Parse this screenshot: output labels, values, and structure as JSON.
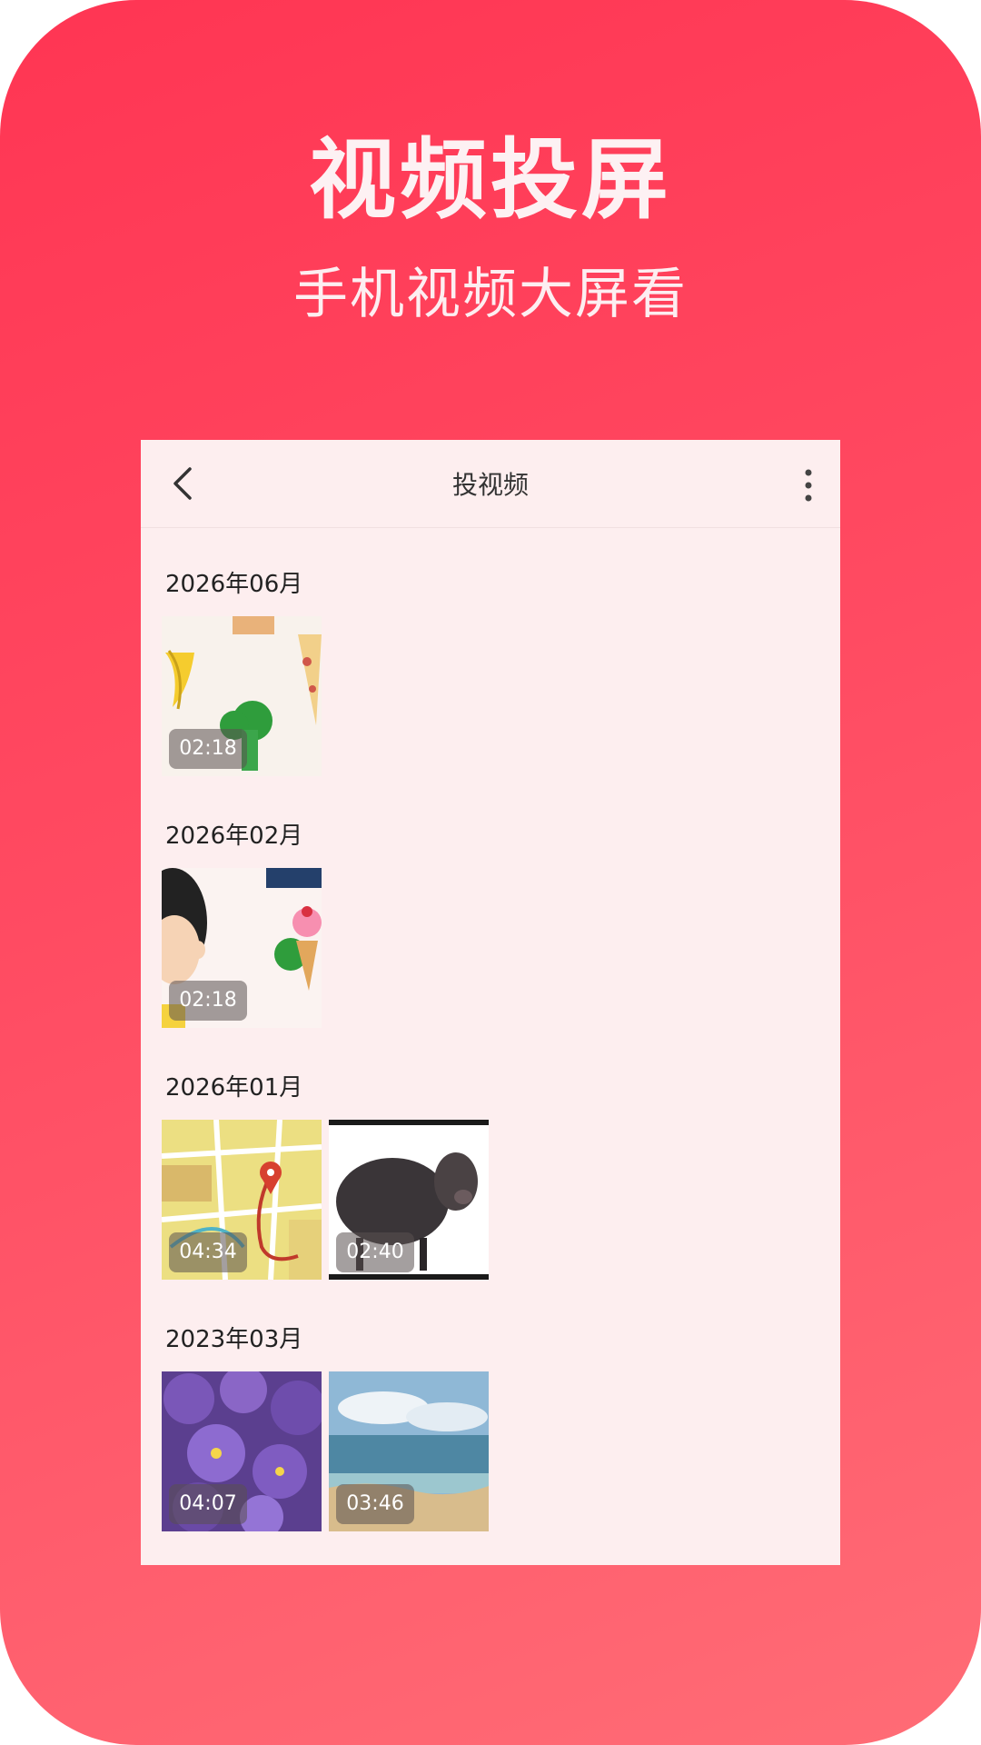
{
  "promo": {
    "title": "视频投屏",
    "subtitle": "手机视频大屏看"
  },
  "screen": {
    "title": "投视频",
    "back_icon": "chevron-left-icon",
    "more_icon": "more-vertical-icon"
  },
  "sections": [
    {
      "date": "2026年06月",
      "videos": [
        {
          "duration": "02:18",
          "thumb": "food-cartoon"
        }
      ]
    },
    {
      "date": "2026年02月",
      "videos": [
        {
          "duration": "02:18",
          "thumb": "girl-icecream-cartoon"
        }
      ]
    },
    {
      "date": "2026年01月",
      "videos": [
        {
          "duration": "04:34",
          "thumb": "map"
        },
        {
          "duration": "02:40",
          "thumb": "black-sheep"
        }
      ]
    },
    {
      "date": "2023年03月",
      "videos": [
        {
          "duration": "04:07",
          "thumb": "purple-flowers"
        },
        {
          "duration": "03:46",
          "thumb": "beach"
        }
      ]
    }
  ],
  "colors": {
    "background_top": "#ff3553",
    "background_bottom": "#ff6c76",
    "panel": "#fdeeef"
  }
}
